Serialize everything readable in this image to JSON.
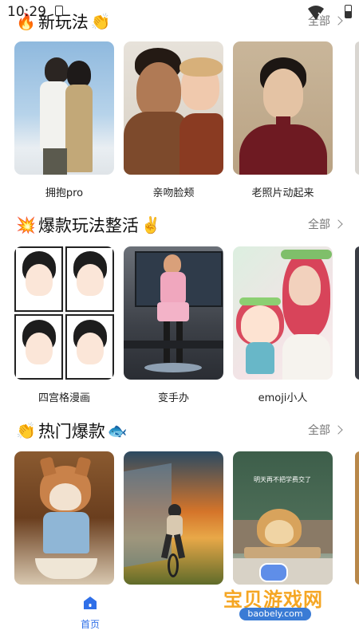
{
  "status_bar": {
    "time": "10:29"
  },
  "sections": [
    {
      "title": "新玩法",
      "emoji_left": "🔥",
      "emoji_right": "👏",
      "all_label": "全部",
      "cards": [
        {
          "label": "拥抱pro",
          "image": "couple-hug-photo"
        },
        {
          "label": "亲吻脸颊",
          "image": "couple-kiss-photo"
        },
        {
          "label": "老照片动起来",
          "image": "old-photo-portrait"
        }
      ]
    },
    {
      "title": "爆款玩法整活",
      "emoji_left": "💥",
      "emoji_right": "✌️",
      "all_label": "全部",
      "cards": [
        {
          "label": "四宫格漫画",
          "image": "four-panel-manga"
        },
        {
          "label": "变手办",
          "image": "figure-toy-photo"
        },
        {
          "label": "emoji小人",
          "image": "emoji-character-photo"
        }
      ]
    },
    {
      "title": "热门爆款",
      "emoji_left": "👏",
      "emoji_right": "🐟",
      "all_label": "全部",
      "cards": [
        {
          "label": "",
          "image": "shiba-baking-photo"
        },
        {
          "label": "",
          "image": "girl-bike-sunset-art"
        },
        {
          "label": "",
          "image": "dog-classroom-photo",
          "overlay_text": "明天再不把学费交了"
        }
      ]
    }
  ],
  "bottom_nav": {
    "home_label": "首页",
    "active_color": "#2f6fe8"
  },
  "watermark": {
    "title": "宝贝游戏网",
    "url": "baobely.com"
  }
}
